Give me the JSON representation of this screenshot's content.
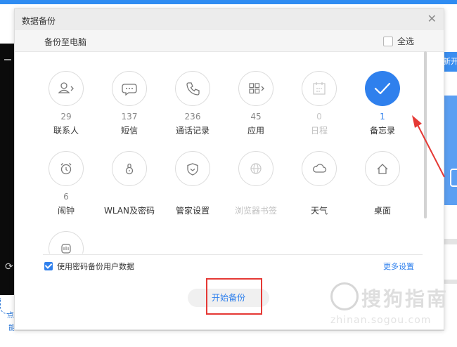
{
  "background": {
    "right_button_label": "新开",
    "left_text_1": "点",
    "left_text_2": "能"
  },
  "dialog": {
    "title": "数据备份",
    "close_icon": "close-icon",
    "sub_header": {
      "title": "备份至电脑",
      "select_all": "全选"
    },
    "items": [
      {
        "label": "联系人",
        "count": "29",
        "icon": "contact-icon",
        "selected": false,
        "enabled": true
      },
      {
        "label": "短信",
        "count": "137",
        "icon": "message-icon",
        "selected": false,
        "enabled": true
      },
      {
        "label": "通话记录",
        "count": "236",
        "icon": "phone-icon",
        "selected": false,
        "enabled": true
      },
      {
        "label": "应用",
        "count": "45",
        "icon": "apps-icon",
        "selected": false,
        "enabled": true
      },
      {
        "label": "日程",
        "count": "0",
        "icon": "calendar-icon",
        "selected": false,
        "enabled": false
      },
      {
        "label": "备忘录",
        "count": "1",
        "icon": "checkmark-icon",
        "selected": true,
        "enabled": true
      },
      {
        "label": "闹钟",
        "count": "6",
        "icon": "alarm-icon",
        "selected": false,
        "enabled": true
      },
      {
        "label": "WLAN及密码",
        "count": "",
        "icon": "wlan-lock-icon",
        "selected": false,
        "enabled": true
      },
      {
        "label": "管家设置",
        "count": "",
        "icon": "shield-icon",
        "selected": false,
        "enabled": true
      },
      {
        "label": "浏览器书签",
        "count": "",
        "icon": "globe-icon",
        "selected": false,
        "enabled": false
      },
      {
        "label": "天气",
        "count": "",
        "icon": "cloud-icon",
        "selected": false,
        "enabled": true
      },
      {
        "label": "桌面",
        "count": "",
        "icon": "home-icon",
        "selected": false,
        "enabled": true
      },
      {
        "label": "",
        "count": "",
        "icon": "hand-icon",
        "selected": false,
        "enabled": true
      }
    ],
    "option_checkbox": "使用密码备份用户数据",
    "more_settings": "更多设置",
    "start_button": "开始备份"
  },
  "annotations": {
    "watermark": "搜狗指南",
    "watermark_sub": "zhinan.sogou.com"
  },
  "colors": {
    "accent": "#2f80ed",
    "annotation": "#e53935"
  }
}
